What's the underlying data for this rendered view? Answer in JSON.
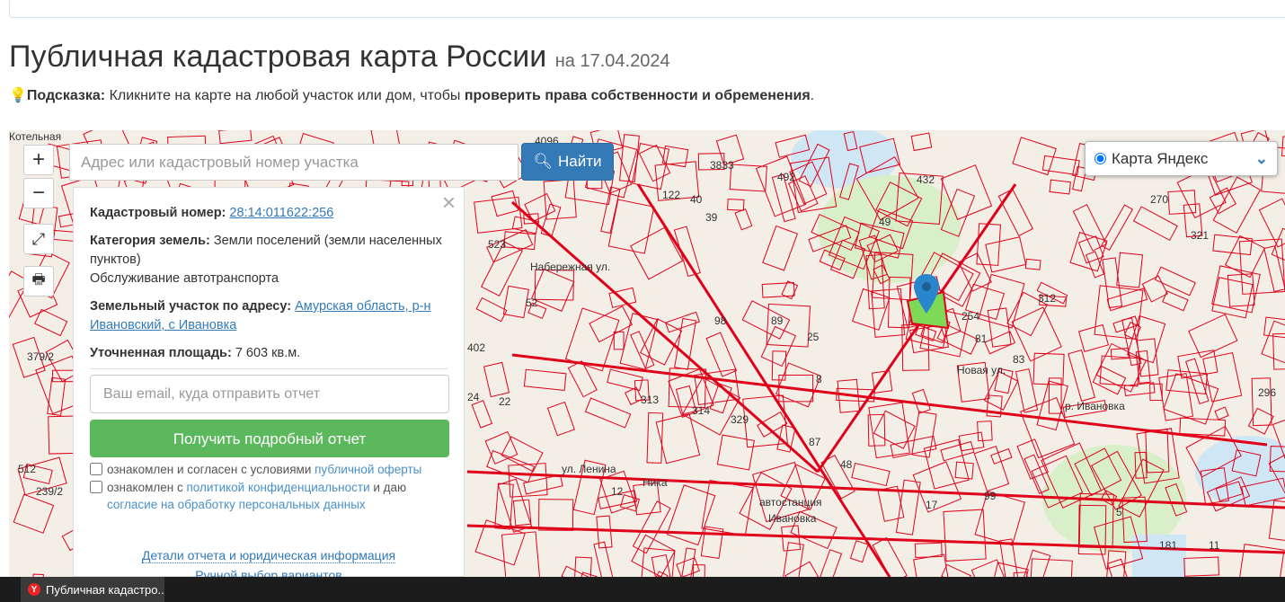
{
  "header": {
    "title": "Публичная кадастровая карта России",
    "date": "на 17.04.2024"
  },
  "hint": {
    "label": "Подсказка:",
    "text1": " Кликните на карте на любой участок или дом, чтобы ",
    "bold": "проверить права собственности и обременения",
    "text2": "."
  },
  "map": {
    "zoom_in": "+",
    "zoom_out": "−",
    "search_placeholder": "Адрес или кадастровый номер участка",
    "search_button": "Найти",
    "layer_selected": "Карта Яндекс",
    "labels": [
      "3833",
      "432",
      "270",
      "321",
      "312",
      "296",
      "254",
      "25",
      "313",
      "314",
      "329",
      "87",
      "8",
      "98",
      "89",
      "52",
      "523",
      "402",
      "379/2",
      "512",
      "239/2",
      "17",
      "181",
      "5",
      "4096",
      "492",
      "49",
      "122",
      "40",
      "39",
      "83",
      "81",
      "22",
      "24",
      "12",
      "48",
      "99",
      "11",
      "Ника",
      "автостанция",
      "Ивановка",
      "ул. Ленина",
      "р. Ивановка",
      "Новая ул.",
      "Набережная ул.",
      "Котельная"
    ],
    "colors": {
      "parcel": "#e0001a",
      "selected": "#7ed957",
      "water": "#cfe6f5",
      "green": "#d9efc9"
    }
  },
  "popup": {
    "cad_label": "Кадастровый номер:",
    "cad_value": "28:14:011622:256",
    "cat_label": "Категория земель:",
    "cat_value": "Земли поселений (земли населенных пунктов)",
    "use": "Обслуживание автотранспорта",
    "addr_label": "Земельный участок по адресу:",
    "addr_value": "Амурская область, р-н Ивановский, с Ивановка",
    "area_label": "Уточненная площадь:",
    "area_value": "7 603 кв.м.",
    "email_placeholder": "Ваш email, куда отправить отчет",
    "report_button": "Получить подробный отчет",
    "chk1_text": "ознакомлен и согласен с условиями ",
    "chk1_link": "публичной оферты",
    "chk2_text": "ознакомлен с ",
    "chk2_link": "политикой конфиденциальности",
    "chk2_text2": " и даю ",
    "chk2_link2": "согласие на обработку персональных данных",
    "details_link": "Детали отчета и юридическая информация",
    "manual_link": "Ручной выбор вариантов",
    "close": "×"
  },
  "taskbar": {
    "tab_title": "Публичная кадастро..."
  }
}
